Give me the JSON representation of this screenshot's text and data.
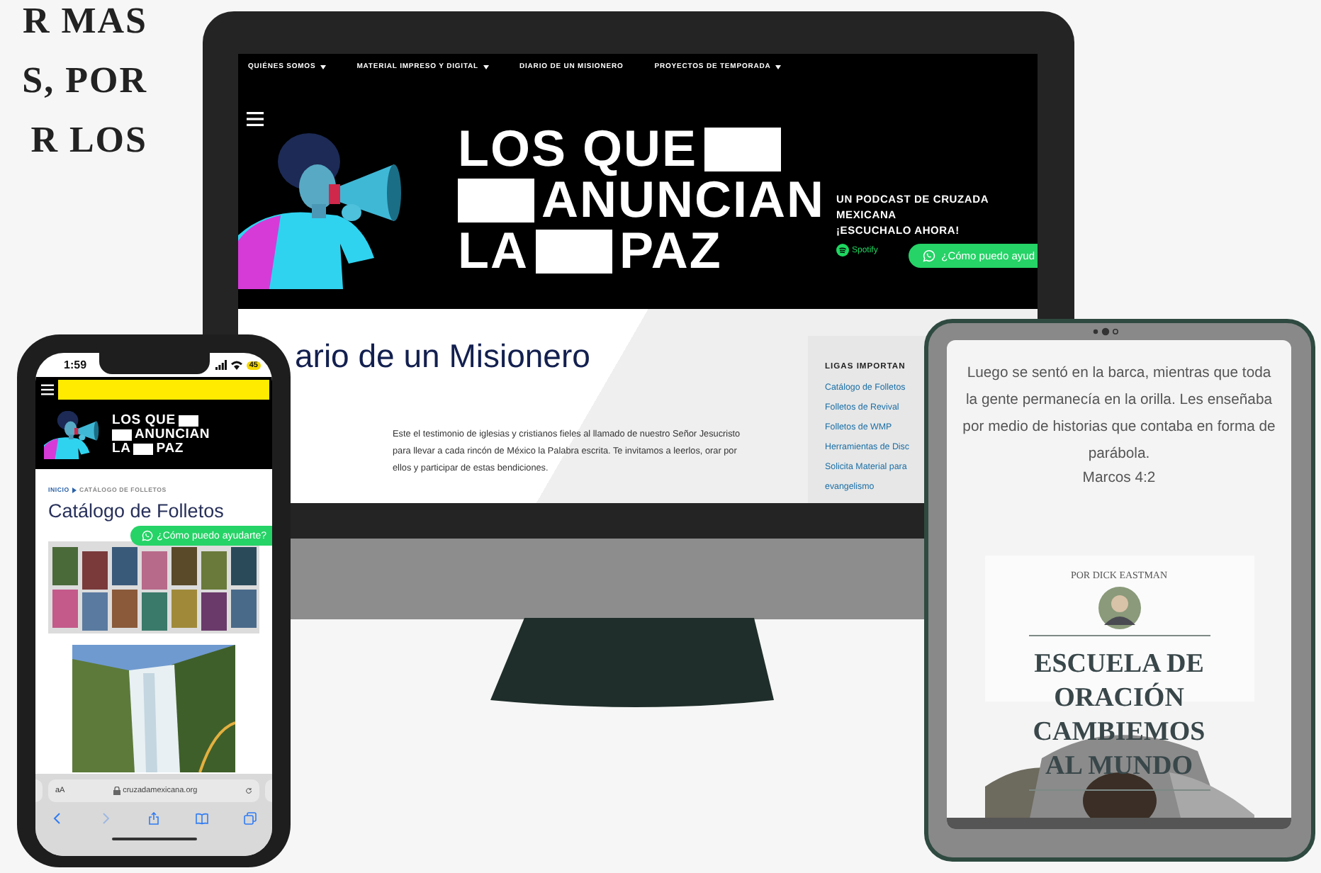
{
  "side_text": [
    "R MAS",
    "S, POR",
    "R LOS"
  ],
  "monitor": {
    "nav": [
      {
        "label": "QUIÉNES SOMOS",
        "dropdown": true
      },
      {
        "label": "MATERIAL IMPRESO Y DIGITAL",
        "dropdown": true
      },
      {
        "label": "DIARIO DE UN MISIONERO",
        "dropdown": false
      },
      {
        "label": "PROYECTOS DE TEMPORADA",
        "dropdown": true
      }
    ],
    "hero": {
      "title_lines": [
        [
          {
            "kind": "text",
            "text": "LOS QUE"
          },
          {
            "kind": "block"
          }
        ],
        [
          {
            "kind": "block"
          },
          {
            "kind": "text",
            "text": "ANUNCIAN"
          }
        ],
        [
          {
            "kind": "text",
            "text": "LA"
          },
          {
            "kind": "block"
          },
          {
            "kind": "text",
            "text": "PAZ"
          }
        ]
      ],
      "podcast_lines": [
        "UN PODCAST DE CRUZADA",
        "MEXICANA",
        "¡ESCUCHALO AHORA!"
      ],
      "spotify": "Spotify",
      "whatsapp": "¿Cómo puedo ayud"
    },
    "page_title": "ario de un Misionero",
    "intro": "Este el testimonio de iglesias y cristianos fieles al llamado de nuestro Señor Jesucristo para llevar a cada rincón de México la Palabra escrita. Te invitamos a leerlos, orar por ellos y participar de estas bendiciones.",
    "sidebar": {
      "title": "LIGAS IMPORTAN",
      "links": [
        "Catálogo de Folletos",
        "Folletos de Revival",
        "Folletos de WMP",
        "Herramientas de Disc",
        "Solicita Material para",
        "evangelismo"
      ]
    }
  },
  "phone": {
    "time": "1:59",
    "battery": "45",
    "hero_lines": [
      [
        {
          "kind": "text",
          "text": "LOS QUE"
        },
        {
          "kind": "block"
        }
      ],
      [
        {
          "kind": "block"
        },
        {
          "kind": "text",
          "text": "ANUNCIAN"
        }
      ],
      [
        {
          "kind": "text",
          "text": "LA"
        },
        {
          "kind": "block"
        },
        {
          "kind": "text",
          "text": "PAZ"
        }
      ]
    ],
    "breadcrumb": {
      "home": "INICIO",
      "current": "CATÁLOGO DE FOLLETOS"
    },
    "title": "Catálogo de Folletos",
    "whatsapp": "¿Cómo puedo ayudarte?",
    "text_size": "aA",
    "url": "cruzadamexicana.org"
  },
  "tablet": {
    "quote": "Luego se sentó en la barca, mientras que toda la gente permanecía en la orilla. Les enseñaba por medio de historias que contaba en forma de parábola.",
    "reference": "Marcos 4:2",
    "book": {
      "author": "POR DICK EASTMAN",
      "title_lines": [
        "ESCUELA DE",
        "ORACIÓN",
        "CAMBIEMOS",
        "AL MUNDO"
      ]
    }
  }
}
